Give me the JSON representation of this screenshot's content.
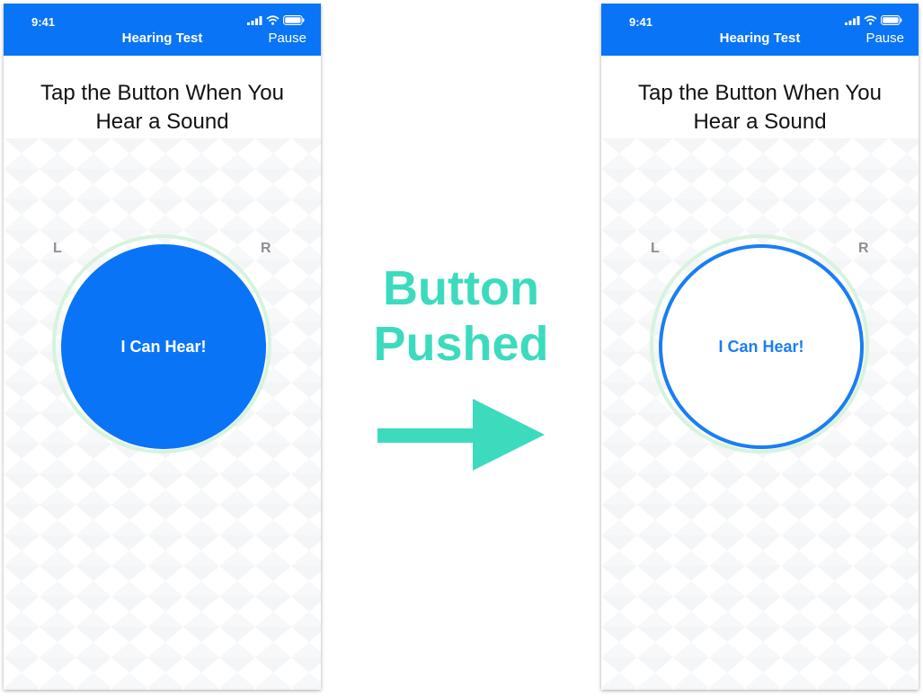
{
  "colors": {
    "accent": "#0a74f7",
    "halo": "#d6f3de",
    "caption": "#3ddbbd"
  },
  "screens": {
    "before": {
      "status_time": "9:41",
      "nav_title": "Hearing Test",
      "nav_action": "Pause",
      "instruction_line1": "Tap the Button When You",
      "instruction_line2": "Hear a Sound",
      "left_label": "L",
      "right_label": "R",
      "button_label": "I Can Hear!",
      "button_state": "unpressed"
    },
    "after": {
      "status_time": "9:41",
      "nav_title": "Hearing Test",
      "nav_action": "Pause",
      "instruction_line1": "Tap the Button When You",
      "instruction_line2": "Hear a Sound",
      "left_label": "L",
      "right_label": "R",
      "button_label": "I Can Hear!",
      "button_state": "pressed"
    }
  },
  "caption": {
    "line1": "Button",
    "line2": "Pushed"
  },
  "icons": [
    "signal-icon",
    "wifi-icon",
    "battery-icon",
    "arrow-right-icon"
  ]
}
